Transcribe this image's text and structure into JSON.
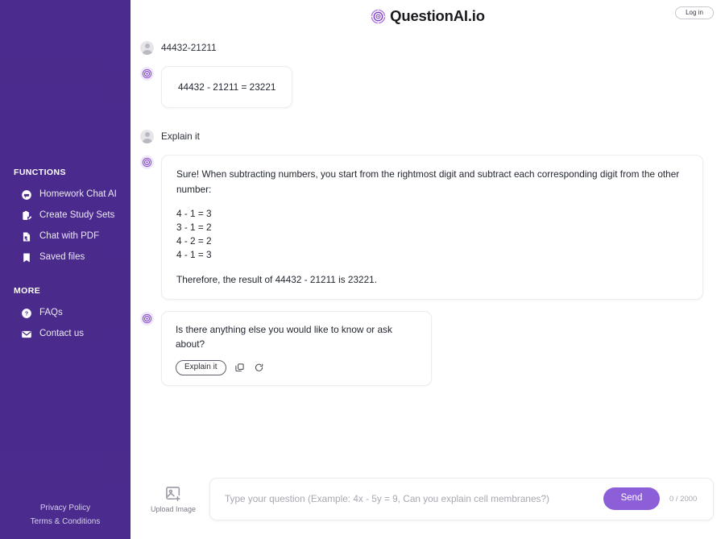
{
  "header": {
    "brand_name": "QuestionAI.io",
    "logo_icon": "target-logo-icon",
    "login_label": "Log in"
  },
  "sidebar": {
    "background_color": "#4a2b8c",
    "sections": [
      {
        "title": "FUNCTIONS",
        "items": [
          {
            "label": "Homework Chat AI",
            "icon": "chat-bubble-icon"
          },
          {
            "label": "Create Study Sets",
            "icon": "clipboard-edit-icon"
          },
          {
            "label": "Chat with PDF",
            "icon": "file-pdf-icon"
          },
          {
            "label": "Saved files",
            "icon": "bookmark-icon"
          }
        ]
      },
      {
        "title": "MORE",
        "items": [
          {
            "label": "FAQs",
            "icon": "question-circle-icon"
          },
          {
            "label": "Contact us",
            "icon": "envelope-icon"
          }
        ]
      }
    ],
    "footer": {
      "privacy": "Privacy Policy",
      "terms": "Terms & Conditions"
    }
  },
  "chat": {
    "messages": [
      {
        "role": "user",
        "text": "44432-21211"
      },
      {
        "role": "assistant",
        "text": "44432 - 21211 = 23221"
      },
      {
        "role": "user",
        "text": "Explain it"
      },
      {
        "role": "assistant",
        "intro": "Sure! When subtracting numbers, you start from the rightmost digit and subtract each corresponding digit from the other number:",
        "steps": [
          "4 - 1 = 3",
          "3 - 1 = 2",
          "4 - 2 = 2",
          "4 - 1 = 3"
        ],
        "conclusion": "Therefore, the result of 44432 - 21211 is 23221."
      },
      {
        "role": "assistant",
        "text": "Is there anything else you would like to know or ask about?",
        "actions": {
          "chip_label": "Explain it",
          "copy_icon": "copy-icon",
          "regenerate_icon": "refresh-icon"
        }
      }
    ]
  },
  "composer": {
    "upload_label": "Upload Image",
    "upload_icon": "image-plus-icon",
    "input_value": "",
    "input_placeholder": "Type your question (Example: 4x - 5y = 9, Can you explain cell membranes?)",
    "send_label": "Send",
    "counter": "0 / 2000",
    "send_color": "#8c5fd9"
  }
}
